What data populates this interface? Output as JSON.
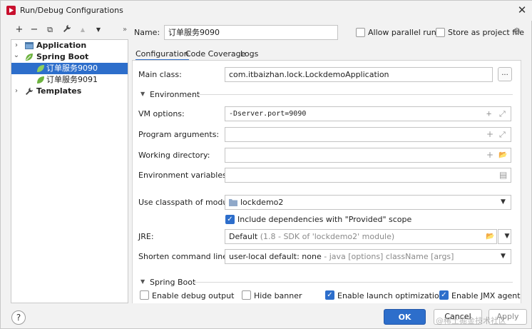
{
  "window": {
    "title": "Run/Debug Configurations",
    "close_glyph": "✕"
  },
  "toolbar": {
    "add": "+",
    "remove": "−",
    "copy": "⧉",
    "wrench": "🔧",
    "up": "▲",
    "down": "▼",
    "more": "»"
  },
  "tree": {
    "items": [
      {
        "label": "Application",
        "chevron": "›"
      },
      {
        "label": "Spring Boot",
        "chevron": "⌄"
      },
      {
        "label": "订单服务9090"
      },
      {
        "label": "订单服务9091"
      },
      {
        "label": "Templates",
        "chevron": "›"
      }
    ]
  },
  "header": {
    "name_label": "Name:",
    "name_value": "订单服务9090",
    "allow_parallel": "Allow parallel run",
    "store_project": "Store as project file"
  },
  "tabs": [
    "Configuration",
    "Code Coverage",
    "Logs"
  ],
  "form": {
    "main_class_label": "Main class:",
    "main_class_value": "com.itbaizhan.lock.LockdemoApplication",
    "dots": "...",
    "environment_section": "Environment",
    "vm_options_label": "VM options:",
    "vm_options_value": "-Dserver.port=9090",
    "program_args_label": "Program arguments:",
    "working_dir_label": "Working directory:",
    "env_vars_label": "Environment variables:",
    "classpath_label": "Use classpath of module:",
    "classpath_value": "lockdemo2",
    "include_deps": "Include dependencies with \"Provided\" scope",
    "jre_label": "JRE:",
    "jre_value": "Default",
    "jre_hint": "(1.8 - SDK of 'lockdemo2' module)",
    "shorten_label": "Shorten command line:",
    "shorten_value": "user-local default: none",
    "shorten_hint": "- java [options] className [args]",
    "spring_boot_section": "Spring Boot",
    "debug_output": "Enable debug output",
    "hide_banner": "Hide banner",
    "launch_opt": "Enable launch optimization",
    "jmx_agent": "Enable JMX agent"
  },
  "footer": {
    "help": "?",
    "ok": "OK",
    "cancel": "Cancel",
    "apply": "Apply",
    "watermark": "@稀土掘金技术社区"
  },
  "icons": {
    "plus": "+",
    "expand": "⤢",
    "folder": "📂",
    "doc": "▤",
    "combo_down": "▼",
    "check": "✓",
    "gear": "⚙"
  }
}
